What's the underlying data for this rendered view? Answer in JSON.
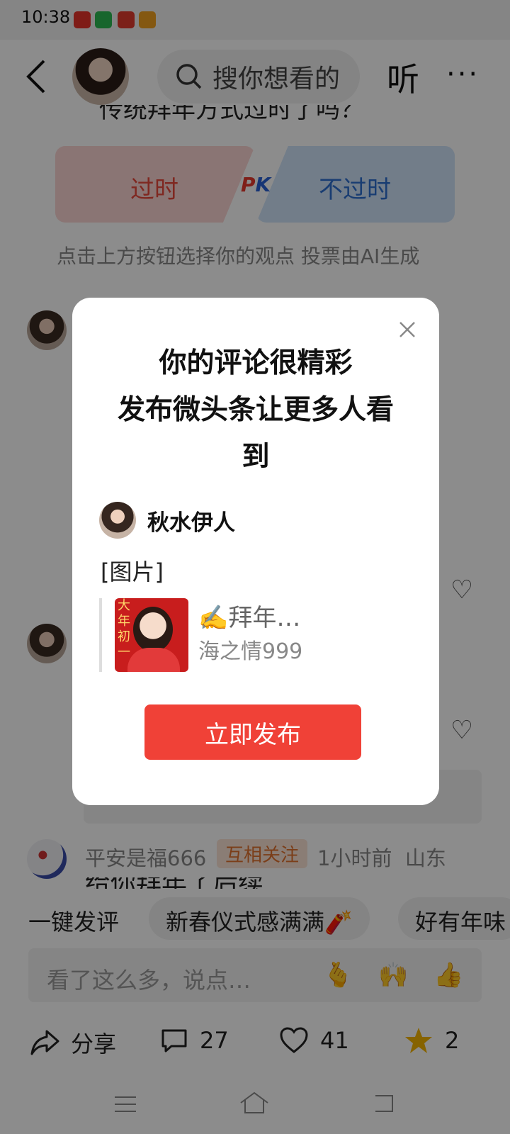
{
  "status_bar": {
    "time": "10:38"
  },
  "header": {
    "search_placeholder": "搜你想看的",
    "listen_label": "听",
    "more_label": "···"
  },
  "article": {
    "partial_question": "传统拜年方式过时了吗？"
  },
  "vote": {
    "left_label": "过时",
    "right_label": "不过时",
    "pk_p": "P",
    "pk_k": "K",
    "hint": "点击上方按钮选择你的观点 投票由AI生成"
  },
  "comments": {
    "third": {
      "user": "平安是福666",
      "badge": "互相关注",
      "time": "1小时前",
      "location": "山东",
      "partial_text": "给你拜年了后续"
    }
  },
  "quick_replies": {
    "label": "一键发评",
    "chips": [
      "新春仪式感满满🧨",
      "好有年味"
    ]
  },
  "input": {
    "placeholder": "看了这么多，说点…",
    "emojis": [
      "🫰",
      "🙌",
      "👍"
    ]
  },
  "actions": {
    "share": "分享",
    "comments": "27",
    "likes": "41",
    "favorites": "2"
  },
  "dialog": {
    "title_line1": "你的评论很精彩",
    "title_line2": "发布微头条让更多人看",
    "title_line3": "到",
    "username": "秋水伊人",
    "image_label": "[图片]",
    "quote_title": "✍️拜年…",
    "quote_author": "海之情999",
    "thumb_text": "大年初一",
    "publish_label": "立即发布"
  },
  "colors": {
    "accent": "#f04137",
    "vote_red": "#e84a3c",
    "vote_blue": "#2f6fcf",
    "star": "#f5b400"
  }
}
